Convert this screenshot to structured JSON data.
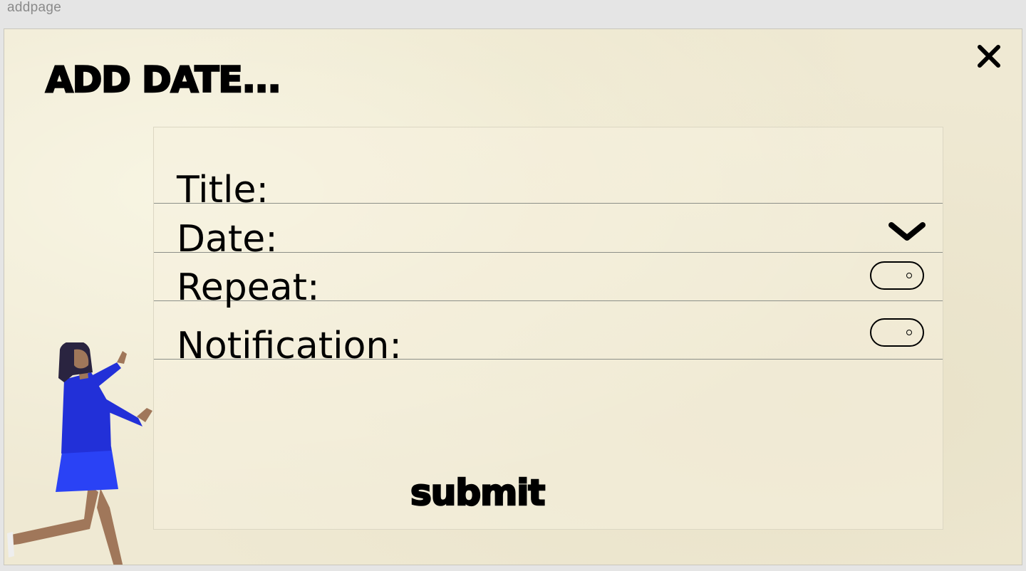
{
  "window": {
    "label": "addpage"
  },
  "header": {
    "title": "ADD DATE...",
    "close_icon": "close-icon"
  },
  "form": {
    "fields": [
      {
        "label": "Title:"
      },
      {
        "label": "Date:",
        "control": "chevron-down-icon"
      },
      {
        "label": "Repeat:",
        "control": "toggle"
      },
      {
        "label": "Notification:",
        "control": "toggle"
      }
    ],
    "submit_label": "submit"
  },
  "colors": {
    "background": "#efe9d3",
    "text": "#000000",
    "divider": "#8c8f88",
    "figure_dress": "#2233d6",
    "figure_skin": "#a0775a"
  }
}
